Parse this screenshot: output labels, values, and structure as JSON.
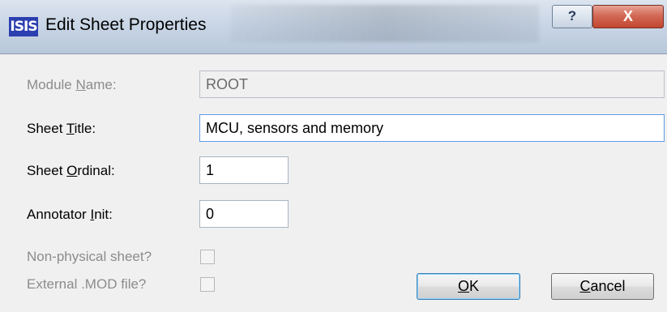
{
  "window": {
    "app_icon_text": "ISIS",
    "title": "Edit Sheet Properties",
    "help_label": "?",
    "close_label": "X"
  },
  "form": {
    "module_name": {
      "label_pre": "Module ",
      "label_ul": "N",
      "label_post": "ame:",
      "value": "ROOT"
    },
    "sheet_title": {
      "label_pre": "Sheet ",
      "label_ul": "T",
      "label_post": "itle:",
      "value": "MCU, sensors and memory"
    },
    "sheet_ordinal": {
      "label_pre": "Sheet ",
      "label_ul": "O",
      "label_post": "rdinal:",
      "value": "1"
    },
    "annotator_init": {
      "label_pre": "Annotator ",
      "label_ul": "I",
      "label_post": "nit:",
      "value": "0"
    },
    "non_physical": {
      "label": "Non-physical sheet?",
      "checked": false
    },
    "external_mod": {
      "label": "External .MOD file?",
      "checked": false
    }
  },
  "buttons": {
    "ok": {
      "ul": "O",
      "rest": "K"
    },
    "cancel": {
      "ul": "C",
      "rest": "ancel"
    }
  }
}
